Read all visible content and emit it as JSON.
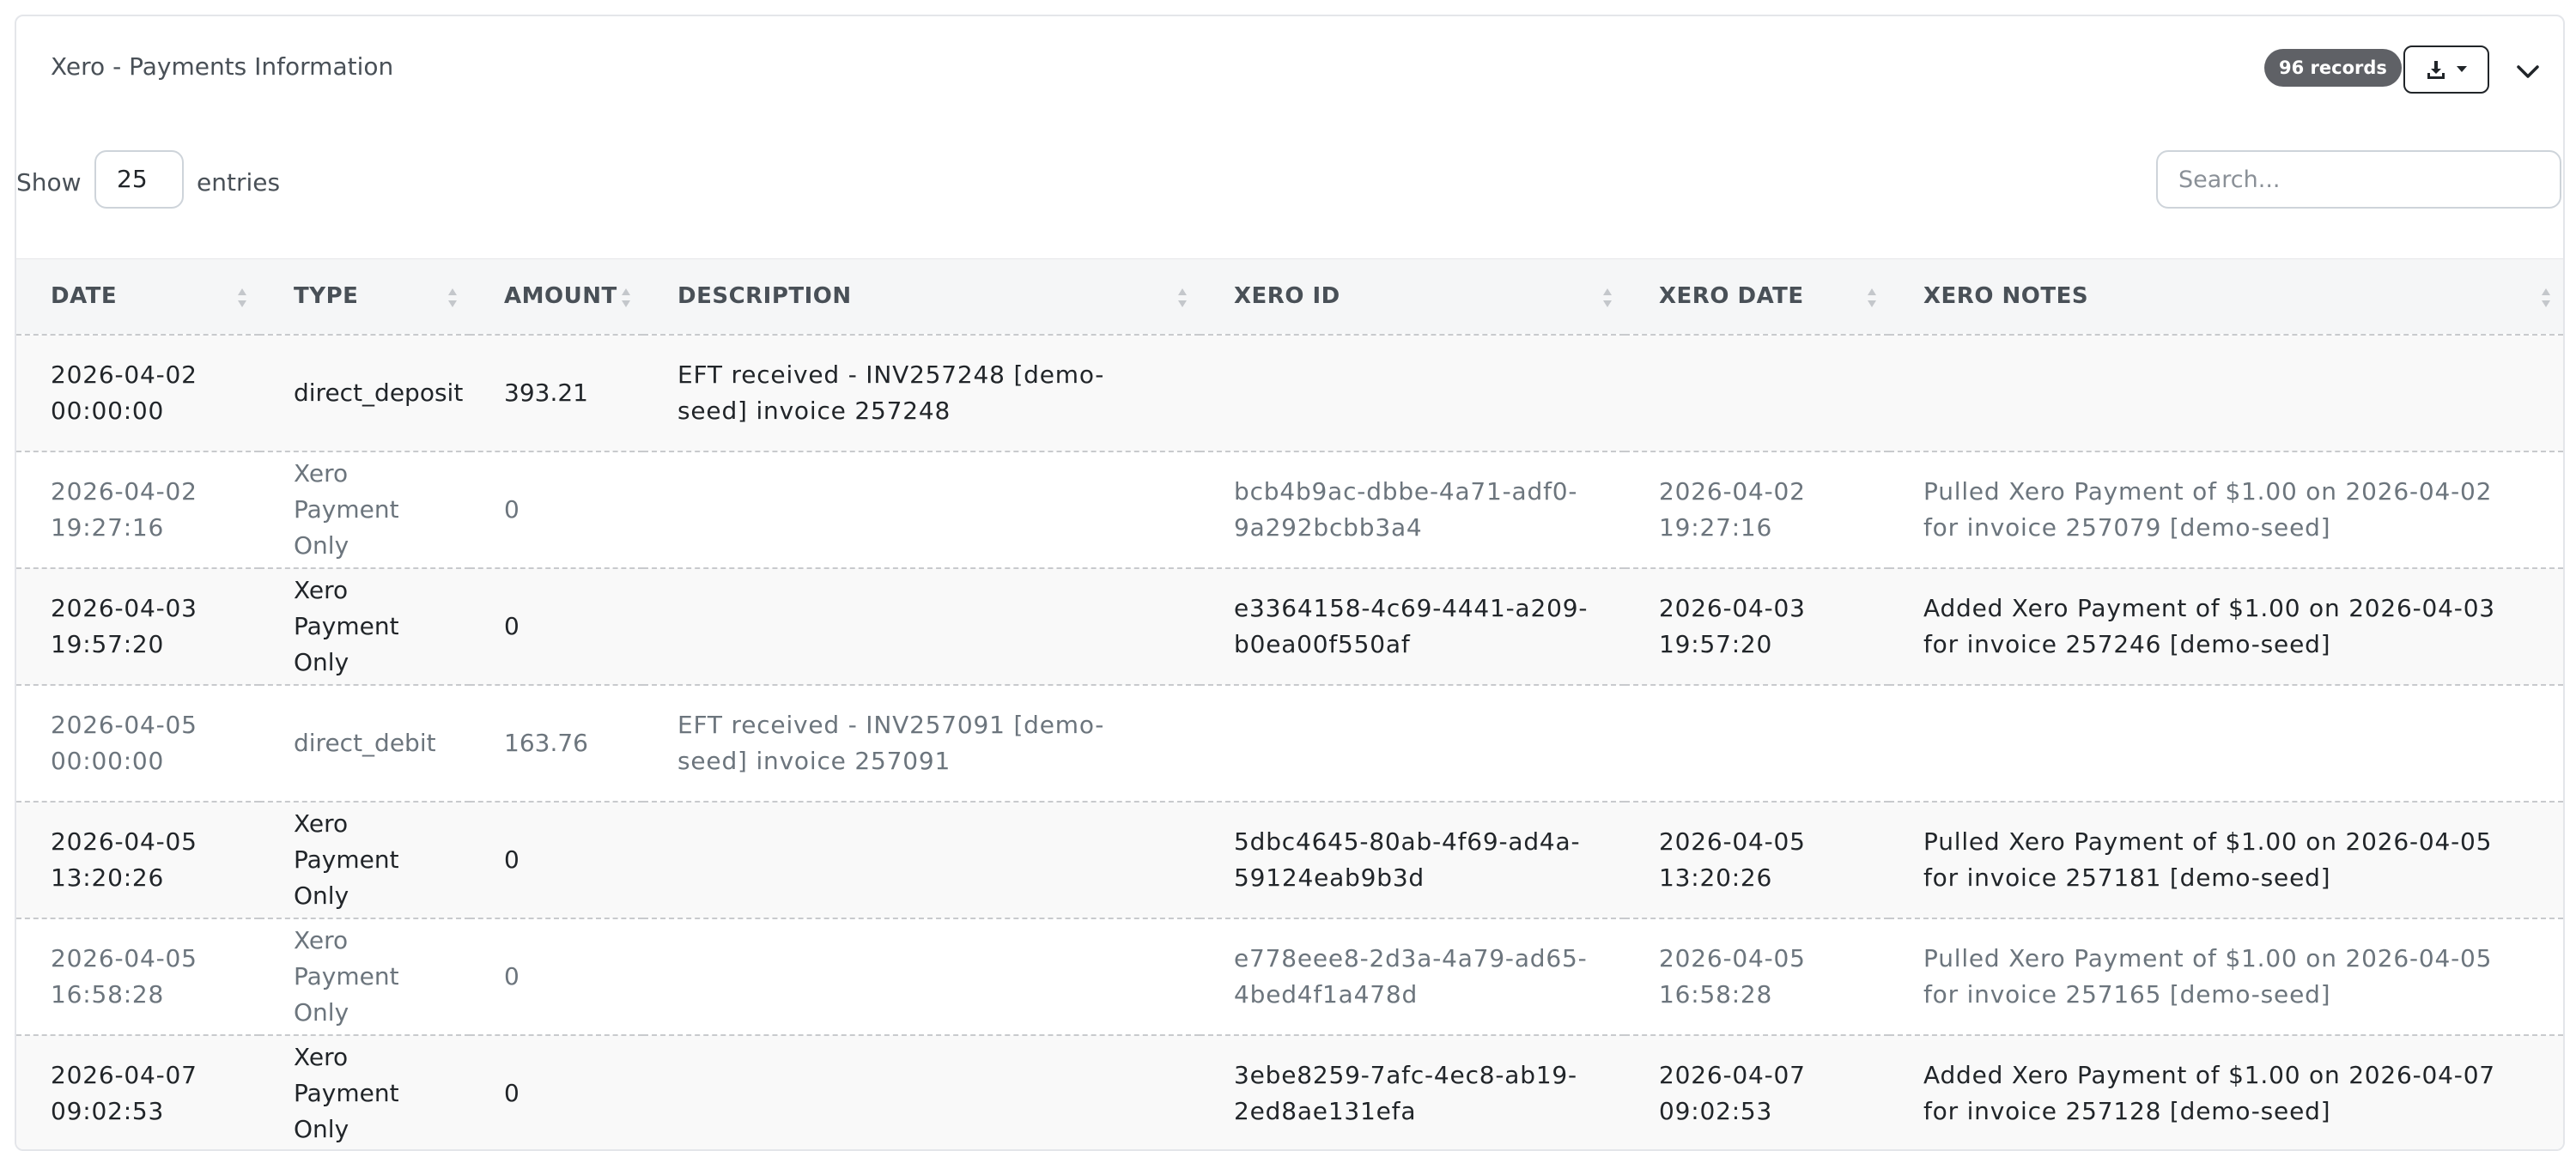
{
  "card": {
    "title": "Xero - Payments Information",
    "records_badge": "96 records"
  },
  "controls": {
    "show_label": "Show",
    "page_length": "25",
    "entries_label": "entries",
    "search_placeholder": "Search..."
  },
  "table": {
    "columns": [
      "DATE",
      "TYPE",
      "AMOUNT",
      "DESCRIPTION",
      "XERO ID",
      "XERO DATE",
      "XERO NOTES"
    ],
    "rows": [
      {
        "date": "2026-04-02 00:00:00",
        "type": "direct_deposit",
        "amount": "393.21",
        "description": "EFT received - INV257248 [demo-seed] invoice 257248",
        "xero_id": "",
        "xero_date": "",
        "xero_notes": ""
      },
      {
        "date": "2026-04-02 19:27:16",
        "type": "Xero Payment Only",
        "amount": "0",
        "description": "",
        "xero_id": "bcb4b9ac-dbbe-4a71-adf0-9a292bcbb3a4",
        "xero_date": "2026-04-02 19:27:16",
        "xero_notes": "Pulled Xero Payment of $1.00 on 2026-04-02 for invoice 257079 [demo-seed]"
      },
      {
        "date": "2026-04-03 19:57:20",
        "type": "Xero Payment Only",
        "amount": "0",
        "description": "",
        "xero_id": "e3364158-4c69-4441-a209-b0ea00f550af",
        "xero_date": "2026-04-03 19:57:20",
        "xero_notes": "Added Xero Payment of $1.00 on 2026-04-03 for invoice 257246 [demo-seed]"
      },
      {
        "date": "2026-04-05 00:00:00",
        "type": "direct_debit",
        "amount": "163.76",
        "description": "EFT received - INV257091 [demo-seed] invoice 257091",
        "xero_id": "",
        "xero_date": "",
        "xero_notes": ""
      },
      {
        "date": "2026-04-05 13:20:26",
        "type": "Xero Payment Only",
        "amount": "0",
        "description": "",
        "xero_id": "5dbc4645-80ab-4f69-ad4a-59124eab9b3d",
        "xero_date": "2026-04-05 13:20:26",
        "xero_notes": "Pulled Xero Payment of $1.00 on 2026-04-05 for invoice 257181 [demo-seed]"
      },
      {
        "date": "2026-04-05 16:58:28",
        "type": "Xero Payment Only",
        "amount": "0",
        "description": "",
        "xero_id": "e778eee8-2d3a-4a79-ad65-4bed4f1a478d",
        "xero_date": "2026-04-05 16:58:28",
        "xero_notes": "Pulled Xero Payment of $1.00 on 2026-04-05 for invoice 257165 [demo-seed]"
      },
      {
        "date": "2026-04-07 09:02:53",
        "type": "Xero Payment Only",
        "amount": "0",
        "description": "",
        "xero_id": "3ebe8259-7afc-4ec8-ab19-2ed8ae131efa",
        "xero_date": "2026-04-07 09:02:53",
        "xero_notes": "Added Xero Payment of $1.00 on 2026-04-07 for invoice 257128 [demo-seed]"
      }
    ]
  },
  "icons": {
    "export": "download-icon",
    "export_caret": "caret-down-icon",
    "collapse": "chevron-down-icon",
    "sort": "sort-icon"
  },
  "colors": {
    "badge_bg": "#5f6166",
    "header_bg": "#f5f6f7",
    "stripe_bg": "#f9f9f9"
  }
}
